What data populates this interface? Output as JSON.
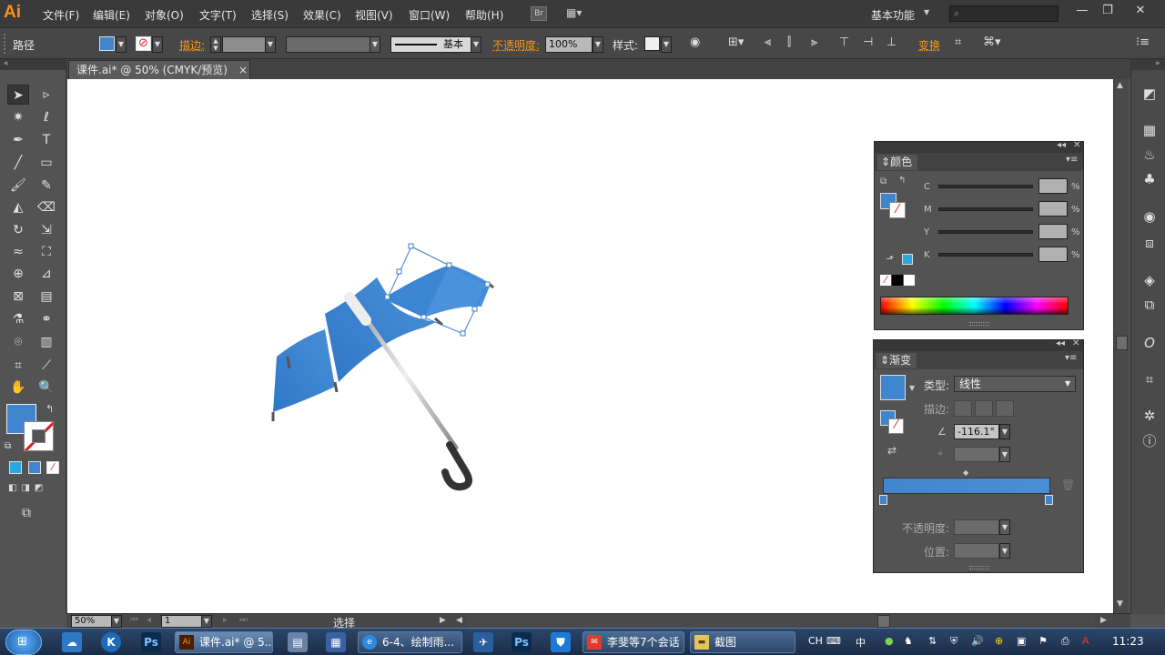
{
  "app": {
    "logo": "Ai"
  },
  "menubar": {
    "items": [
      "文件(F)",
      "编辑(E)",
      "对象(O)",
      "文字(T)",
      "选择(S)",
      "效果(C)",
      "视图(V)",
      "窗口(W)",
      "帮助(H)"
    ],
    "bridge": "Br",
    "workspace": "基本功能",
    "search_placeholder": ""
  },
  "controlbar": {
    "selection_type": "路径",
    "stroke_label": "描边:",
    "stroke_profile": "基本",
    "opacity_label": "不透明度:",
    "opacity_value": "100%",
    "style_label": "样式:",
    "transform_label": "变换"
  },
  "document": {
    "tab_title": "课件.ai* @ 50% (CMYK/预览)",
    "close": "×"
  },
  "color_panel": {
    "title": "颜色",
    "channels": [
      "C",
      "M",
      "Y",
      "K"
    ],
    "unit": "%"
  },
  "gradient_panel": {
    "title": "渐变",
    "type_label": "类型:",
    "type_value": "线性",
    "stroke_label": "描边:",
    "angle_value": "-116.1°",
    "opacity_label": "不透明度:",
    "position_label": "位置:"
  },
  "statusbar": {
    "zoom": "50%",
    "page": "1",
    "tool": "选择"
  },
  "taskbar": {
    "items": [
      {
        "label": "课件.ai* @ 5...",
        "icon": "Ai"
      },
      {
        "label": "6-4、绘制雨...",
        "icon": "IE"
      },
      {
        "label": "李斐等7个会话",
        "icon": "Q"
      },
      {
        "label": "截图",
        "icon": "F"
      }
    ],
    "lang": "CH",
    "time": "11:23"
  },
  "colors": {
    "accent_blue": "#3f86cf",
    "swatch_cyan": "#29a7df",
    "orange_label": "#f7941d"
  }
}
